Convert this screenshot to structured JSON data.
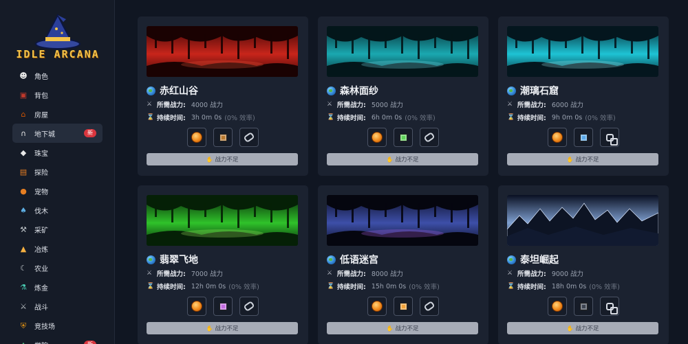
{
  "app": {
    "title": "IDLE ARCANA"
  },
  "nav": [
    {
      "label": "角色",
      "icon": "character-icon",
      "glyph": "☻",
      "color": "#e8e8e8"
    },
    {
      "label": "背包",
      "icon": "backpack-icon",
      "glyph": "▣",
      "color": "#c0392b"
    },
    {
      "label": "房屋",
      "icon": "house-icon",
      "glyph": "⌂",
      "color": "#d35400"
    },
    {
      "label": "地下城",
      "icon": "dungeon-icon",
      "glyph": "∩",
      "color": "#e8e8e8",
      "badge": "新",
      "active": true
    },
    {
      "label": "珠宝",
      "icon": "jewel-icon",
      "glyph": "◆",
      "color": "#e8e8e8"
    },
    {
      "label": "探险",
      "icon": "adventure-map-icon",
      "glyph": "▤",
      "color": "#e67e22"
    },
    {
      "label": "宠物",
      "icon": "pet-icon",
      "glyph": "●",
      "color": "#e67e22"
    },
    {
      "label": "伐木",
      "icon": "axe-icon",
      "glyph": "♠",
      "color": "#5dade2"
    },
    {
      "label": "采矿",
      "icon": "pickaxe-icon",
      "glyph": "⚒",
      "color": "#bdc3c7"
    },
    {
      "label": "冶炼",
      "icon": "anvil-icon",
      "glyph": "▲",
      "color": "#f5b041"
    },
    {
      "label": "农业",
      "icon": "sickle-icon",
      "glyph": "☾",
      "color": "#bdc3c7"
    },
    {
      "label": "炼金",
      "icon": "alchemy-icon",
      "glyph": "⚗",
      "color": "#48c9b0"
    },
    {
      "label": "战斗",
      "icon": "sword-icon",
      "glyph": "⚔",
      "color": "#bdc3c7"
    },
    {
      "label": "竞技场",
      "icon": "arena-shield-icon",
      "glyph": "⛨",
      "color": "#f39c12"
    },
    {
      "label": "学院",
      "icon": "academy-icon",
      "glyph": "✦",
      "color": "#58d68d",
      "badge": "新"
    }
  ],
  "labels": {
    "power": "所需战力:",
    "duration": "持续时间:",
    "insufficient": "战力不足"
  },
  "dungeons": [
    {
      "name": "赤红山谷",
      "power": "4000 战力",
      "duration": "3h 0m 0s",
      "efficiency": "(0% 效率)",
      "theme": "red",
      "rewards": [
        {
          "icon": "gold-coin-icon",
          "type": "coin"
        },
        {
          "icon": "brown-gem-icon",
          "type": "gem",
          "color": "#b8782e"
        },
        {
          "icon": "ring-icon",
          "type": "ring"
        }
      ]
    },
    {
      "name": "森林面纱",
      "power": "5000 战力",
      "duration": "6h 0m 0s",
      "efficiency": "(0% 效率)",
      "theme": "forest",
      "rewards": [
        {
          "icon": "gold-coin-icon",
          "type": "coin"
        },
        {
          "icon": "green-gem-icon",
          "type": "gem",
          "color": "#5fd35a"
        },
        {
          "icon": "ring-icon",
          "type": "ring"
        }
      ]
    },
    {
      "name": "潮璃石窟",
      "power": "6000 战力",
      "duration": "9h 0m 0s",
      "efficiency": "(0% 效率)",
      "theme": "cyan",
      "rewards": [
        {
          "icon": "gold-coin-icon",
          "type": "coin"
        },
        {
          "icon": "blue-gem-icon",
          "type": "gem",
          "color": "#5aa8e8"
        },
        {
          "icon": "double-ring-icon",
          "type": "ring2"
        }
      ]
    },
    {
      "name": "翡翠飞地",
      "power": "7000 战力",
      "duration": "12h 0m 0s",
      "efficiency": "(0% 效率)",
      "theme": "emerald",
      "rewards": [
        {
          "icon": "gold-coin-icon",
          "type": "coin"
        },
        {
          "icon": "purple-gem-icon",
          "type": "gem",
          "color": "#c26ae0"
        },
        {
          "icon": "ring-icon",
          "type": "ring"
        }
      ]
    },
    {
      "name": "低语迷宫",
      "power": "8000 战力",
      "duration": "15h 0m 0s",
      "efficiency": "(0% 效率)",
      "theme": "violet",
      "rewards": [
        {
          "icon": "gold-coin-icon",
          "type": "coin"
        },
        {
          "icon": "orange-gem-icon",
          "type": "gem",
          "color": "#f0a23a"
        },
        {
          "icon": "ring-icon",
          "type": "ring"
        }
      ]
    },
    {
      "name": "泰坦崛起",
      "power": "9000 战力",
      "duration": "18h 0m 0s",
      "efficiency": "(0% 效率)",
      "theme": "mountain",
      "rewards": [
        {
          "icon": "gold-coin-icon",
          "type": "coin"
        },
        {
          "icon": "dark-gem-icon",
          "type": "gem",
          "color": "#3b4250"
        },
        {
          "icon": "double-ring-icon",
          "type": "ring2"
        }
      ]
    }
  ]
}
